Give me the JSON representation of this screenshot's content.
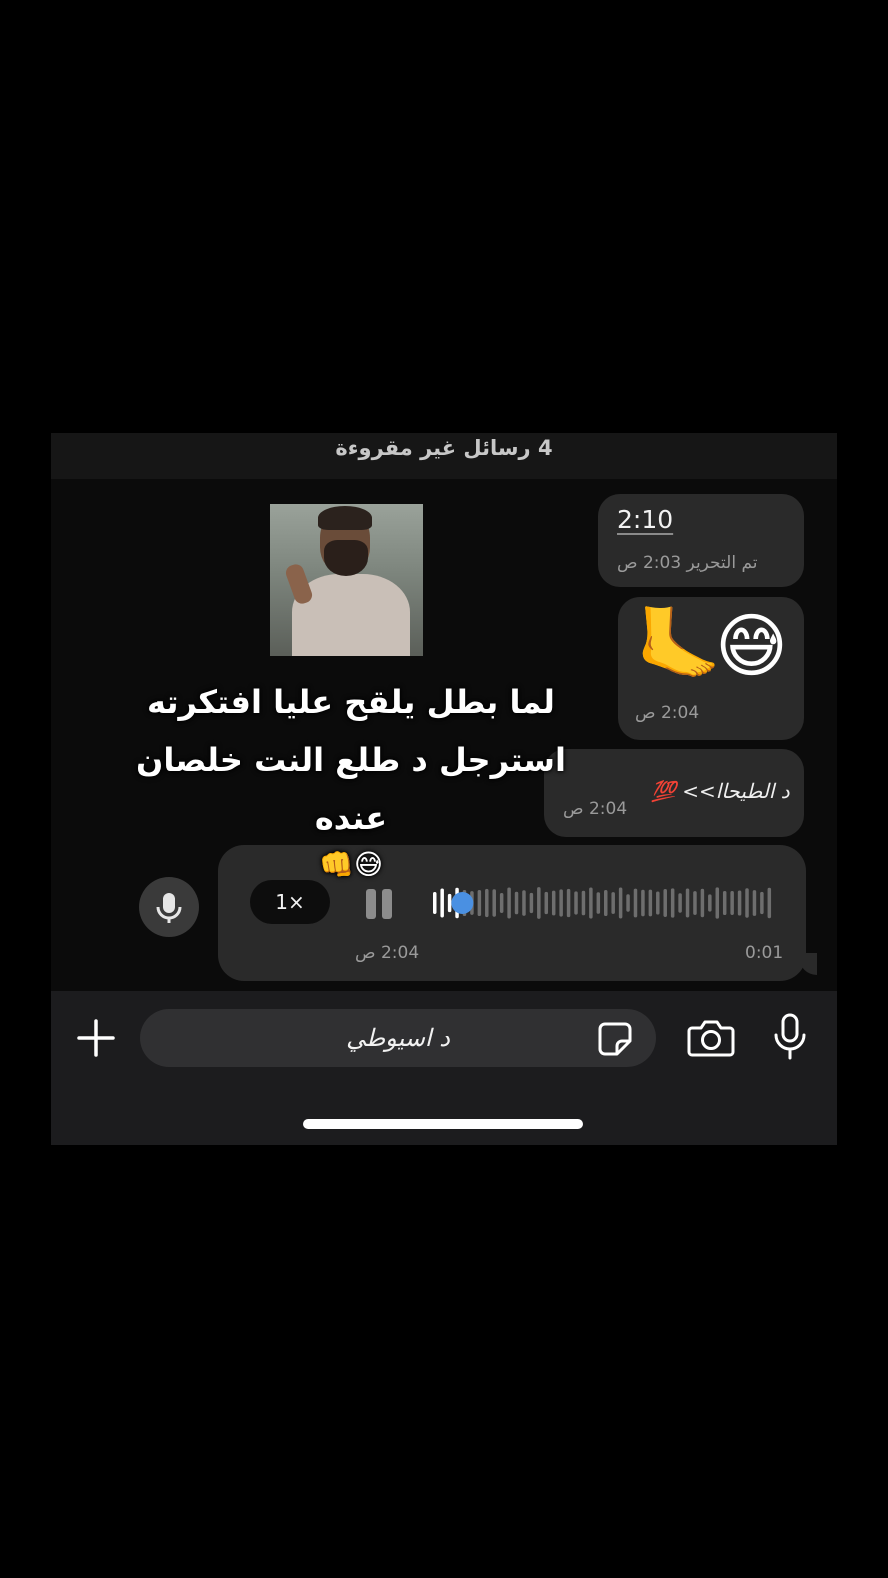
{
  "chat": {
    "unread_banner": "4 رسائل غير مقروءة",
    "messages": [
      {
        "text": "2:10",
        "status": "تم التحرير 2:03 ص"
      },
      {
        "emoji": [
          "😅",
          "🦶"
        ],
        "time": "2:04 ص"
      },
      {
        "text": "د الطيحاا>> 💯",
        "time": "2:04 ص"
      },
      {
        "type": "voice",
        "speed": "1×",
        "duration": "0:01",
        "time": "2:04 ص",
        "progress": 0.08
      }
    ]
  },
  "overlay": {
    "line1": "لما بطل يلقح عليا افتكرته",
    "line2": "استرجل د طلع النت خلصان عنده",
    "line3": "😅👊"
  },
  "input_bar": {
    "value": "د اسيوطي"
  },
  "colors": {
    "bubble": "#2a2a2a",
    "progress_dot": "#4a90e2",
    "background": "#0b0b0b"
  },
  "icons": {
    "plus": "plus-icon",
    "sticker": "sticker-icon",
    "camera": "camera-icon",
    "mic": "microphone-icon",
    "pause": "pause-icon"
  }
}
